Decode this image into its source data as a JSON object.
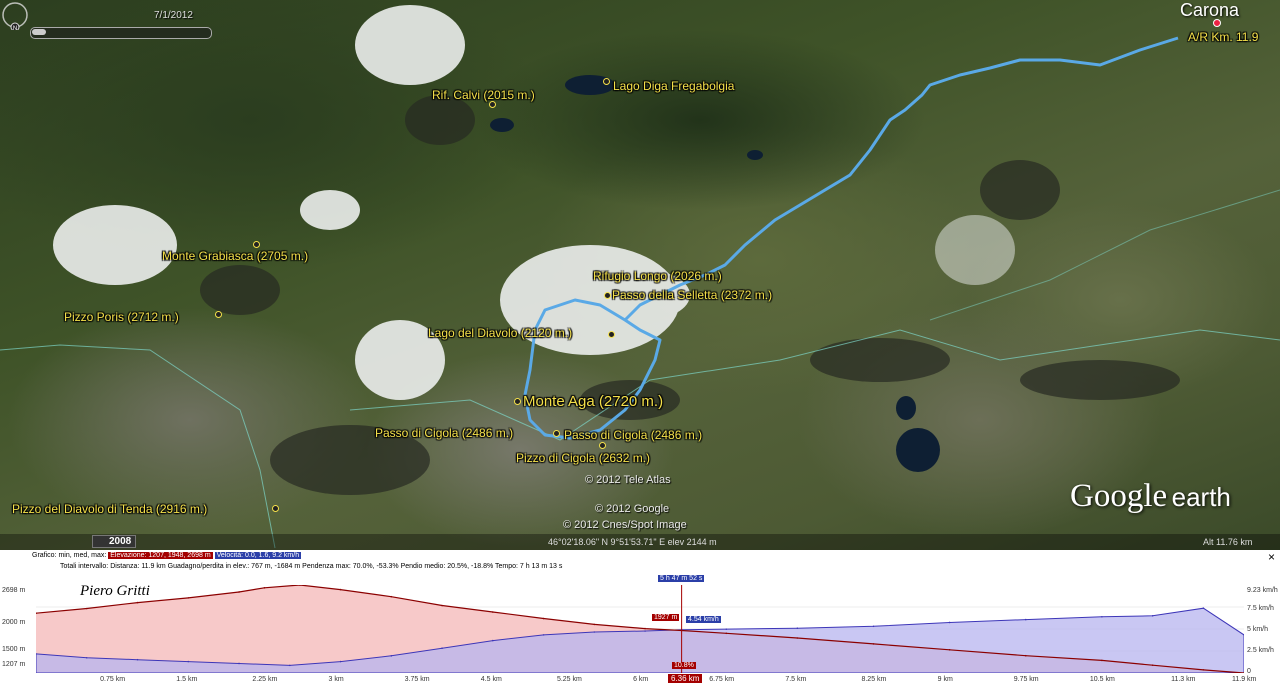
{
  "map": {
    "timeslider_date": "7/1/2012",
    "town": "Carona",
    "route_label": "A/R Km. 11.9",
    "compass": "N",
    "labels": [
      {
        "id": "rif-calvi",
        "text": "Rif. Calvi (2015 m.)"
      },
      {
        "id": "lago-diga",
        "text": "Lago Diga Fregabolgia"
      },
      {
        "id": "monte-grabiasca",
        "text": "Monte Grabiasca (2705 m.)"
      },
      {
        "id": "pizzo-poris",
        "text": "Pizzo Poris (2712 m.)"
      },
      {
        "id": "rifugio-longo",
        "text": "Rifugio Longo (2026 m.)"
      },
      {
        "id": "passo-selletta",
        "text": "Passo della Selletta (2372 m.)"
      },
      {
        "id": "lago-diavolo",
        "text": "Lago del Diavolo (2120 m.)"
      },
      {
        "id": "monte-aga",
        "text": "Monte Aga (2720 m.)"
      },
      {
        "id": "passo-cigola-1",
        "text": "Passo di Cigola (2486 m.)"
      },
      {
        "id": "passo-cigola-2",
        "text": "Passo di Cigola (2486 m.)"
      },
      {
        "id": "pizzo-cigola",
        "text": "Pizzo di Cigola (2632 m.)"
      },
      {
        "id": "pizzo-diavolo-tenda",
        "text": "Pizzo del Diavolo di Tenda (2916 m.)"
      }
    ],
    "copyright_1": "© 2012 Tele Atlas",
    "copyright_2": "© 2012 Google",
    "copyright_3": "© 2012 Cnes/Spot Image",
    "logo_google": "Google",
    "logo_earth": "earth",
    "year": "2008",
    "coordinates": "46°02'18.06\" N   9°51'53.71\" E  elev  2144 m",
    "eye_alt": "Alt   11.76 km"
  },
  "profile": {
    "info_graph_prefix": "Grafico: min, med, max:",
    "info_elevation": "Elevazione: 1207, 1948, 2698 m",
    "info_speed": "Velocità: 0.0, 1.6, 9.2 km/h",
    "info_totals": "Totali intervallo:  Distanza: 11.9 km    Guadagno/perdita in elev.: 767 m, -1684 m    Pendenza max: 70.0%, -53.3%   Pendio medio: 20.5%, -18.8%   Tempo: 7 h 13 m 13 s",
    "close": "×",
    "author": "Piero Gritti",
    "cursor_time": "5 h 47 m 52 s",
    "cursor_elev": "1927 m",
    "cursor_speed": "4.54 km/h",
    "cursor_grade": "10.8%",
    "cursor_dist": "6.36 km",
    "y_left": [
      "2698 m",
      "2000 m",
      "1500 m",
      "1207 m"
    ],
    "y_right": [
      "9.23 km/h",
      "7.5 km/h",
      "5 km/h",
      "2.5 km/h",
      "0"
    ],
    "x_ticks": [
      "0.75 km",
      "1.5 km",
      "2.25 km",
      "3 km",
      "3.75 km",
      "4.5 km",
      "5.25 km",
      "6 km",
      "6.75 km",
      "7.5 km",
      "8.25 km",
      "9 km",
      "9.75 km",
      "10.5 km",
      "11.3 km",
      "11.9 km"
    ]
  },
  "chart_data": {
    "type": "area",
    "title": "",
    "xlabel": "",
    "ylabel": "",
    "x_unit": "km",
    "xlim": [
      0,
      11.9
    ],
    "ylim": [
      1207,
      2698
    ],
    "y2lim": [
      0,
      9.23
    ],
    "series": [
      {
        "name": "Elevazione",
        "axis": "left",
        "x": [
          0,
          0.5,
          1.0,
          1.5,
          2.0,
          2.25,
          2.6,
          3.0,
          3.5,
          4.0,
          4.5,
          5.0,
          5.5,
          6.0,
          6.36,
          6.8,
          7.5,
          8.25,
          9.0,
          9.75,
          10.5,
          11.0,
          11.5,
          11.9
        ],
        "values": [
          2220,
          2300,
          2400,
          2480,
          2580,
          2650,
          2698,
          2620,
          2500,
          2350,
          2240,
          2130,
          2030,
          1960,
          1927,
          1880,
          1800,
          1700,
          1600,
          1500,
          1420,
          1340,
          1260,
          1207
        ]
      },
      {
        "name": "Velocità",
        "axis": "right",
        "x": [
          0,
          0.5,
          1.0,
          1.5,
          2.0,
          2.5,
          3.0,
          3.5,
          4.0,
          4.5,
          5.0,
          5.5,
          6.0,
          6.36,
          6.8,
          7.5,
          8.25,
          9.0,
          9.75,
          10.5,
          11.0,
          11.5,
          11.9
        ],
        "values": [
          2.0,
          1.6,
          1.4,
          1.2,
          1.0,
          0.8,
          1.2,
          1.8,
          2.6,
          3.4,
          4.0,
          4.3,
          4.4,
          4.54,
          4.6,
          4.7,
          4.9,
          5.3,
          5.6,
          5.9,
          6.0,
          6.8,
          4.0
        ]
      }
    ]
  }
}
